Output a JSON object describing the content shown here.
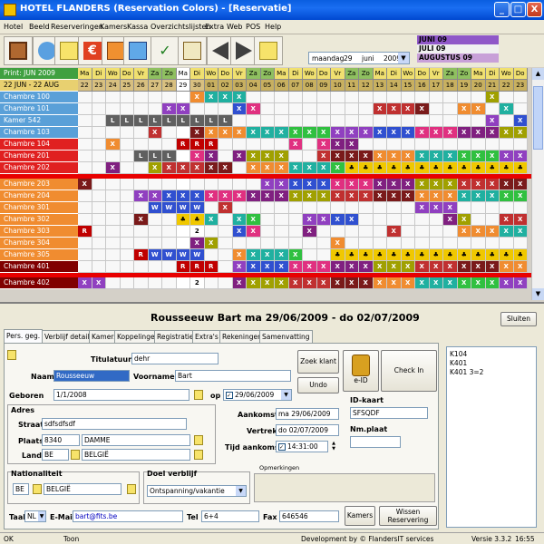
{
  "window": {
    "title": "HOTEL FLANDERS  (Reservation Colors) - [Reservatie]",
    "btn_min": "_",
    "btn_max": "□",
    "btn_close": "X"
  },
  "menu": [
    "Hotel",
    "Beeld",
    "Reserveringen",
    "Kamers",
    "Kassa",
    "Overzichtslijsten",
    "Extra",
    "Web",
    "POS",
    "Help"
  ],
  "toolbar": {
    "date": {
      "day_name": "maandag",
      "day": "29",
      "month": "juni",
      "year": "2009"
    },
    "months": [
      {
        "label": "JUNI 09",
        "color": "#8f57c8"
      },
      {
        "label": "JULI 09",
        "color": "#f0f0f0"
      },
      {
        "label": "AUGUSTUS 09",
        "color": "#c8a0d8"
      }
    ]
  },
  "planner": {
    "print_label": "Print: JUN 2009",
    "range_label": "22 JUN - 22 AUG",
    "weekdays": [
      "Ma",
      "Di",
      "Wo",
      "Do",
      "Vr",
      "Za",
      "Zo",
      "Ma",
      "Di",
      "Wo",
      "Do",
      "Vr",
      "Za",
      "Zo",
      "Ma",
      "Di",
      "Wo",
      "Do",
      "Vr",
      "Za",
      "Zo",
      "Ma",
      "Di",
      "Wo",
      "Do",
      "Vr",
      "Za",
      "Zo",
      "Ma",
      "Di",
      "Wo",
      "Do"
    ],
    "dates": [
      "22",
      "23",
      "24",
      "25",
      "26",
      "27",
      "28",
      "29",
      "30",
      "01",
      "02",
      "03",
      "04",
      "05",
      "06",
      "07",
      "08",
      "09",
      "10",
      "11",
      "12",
      "13",
      "14",
      "15",
      "16",
      "17",
      "18",
      "19",
      "20",
      "21",
      "22",
      "23"
    ],
    "rooms": [
      {
        "name": "Chambre 100",
        "color": "#5aa0d8",
        "cells": {
          "8": "X",
          "9": "X",
          "10": "X",
          "11": "X",
          "29": "X"
        }
      },
      {
        "name": "Chambre 101",
        "color": "#5aa0d8",
        "cells": {
          "6": "X",
          "7": "X",
          "11": "X",
          "12": "X",
          "21": "X",
          "22": "X",
          "23": "X",
          "24": "X",
          "27": "X",
          "28": "X",
          "30": "X"
        }
      },
      {
        "name": "Kamer 542",
        "color": "#5aa0d8",
        "cells": {
          "2": "L",
          "3": "L",
          "4": "L",
          "5": "L",
          "6": "L",
          "7": "L",
          "8": "L",
          "9": "L",
          "10": "L",
          "29": "X",
          "31": "X"
        }
      },
      {
        "name": "Chambre 103",
        "color": "#5aa0d8",
        "cells": {
          "5": "X",
          "8": "X",
          "9": "X",
          "10": "X",
          "11": "X",
          "12": "X",
          "13": "X",
          "14": "X",
          "15": "X",
          "16": "X",
          "17": "X",
          "18": "X",
          "19": "X",
          "20": "X",
          "21": "X",
          "22": "X",
          "23": "X",
          "24": "X",
          "25": "X",
          "26": "X",
          "27": "X",
          "28": "X",
          "29": "X",
          "30": "X",
          "31": "X"
        }
      },
      {
        "name": "Chambre 104",
        "color": "#e02020",
        "cells": {
          "2": "X",
          "7": "R",
          "8": "R",
          "9": "R",
          "15": "X",
          "17": "X",
          "18": "X",
          "19": "X"
        }
      },
      {
        "name": "Chambre 201",
        "color": "#e02020",
        "cells": {
          "4": "L",
          "5": "L",
          "6": "L",
          "8": "X",
          "9": "X",
          "11": "X",
          "12": "X",
          "13": "X",
          "14": "X",
          "17": "X",
          "18": "X",
          "19": "X",
          "20": "X",
          "21": "X",
          "22": "X",
          "23": "X",
          "24": "X",
          "25": "X",
          "26": "X",
          "27": "X",
          "28": "X",
          "29": "X",
          "30": "X",
          "31": "X"
        }
      },
      {
        "name": "Chambre 202",
        "color": "#e02020",
        "cells": {
          "2": "X",
          "5": "X",
          "6": "X",
          "7": "X",
          "8": "X",
          "9": "X",
          "10": "X",
          "12": "X",
          "13": "X",
          "14": "X",
          "15": "X",
          "16": "X",
          "17": "X",
          "18": "X",
          "19": "♣",
          "20": "♣",
          "21": "♣",
          "22": "♣",
          "23": "♣",
          "24": "♣",
          "25": "♣",
          "26": "♣",
          "27": "♣",
          "28": "♣",
          "29": "♣",
          "30": "♣",
          "31": "♣"
        }
      },
      {
        "name": "Chambre 203",
        "color": "#f08c30",
        "cells": {
          "0": "X",
          "13": "X",
          "14": "X",
          "15": "X",
          "16": "X",
          "17": "X",
          "18": "X",
          "19": "X",
          "20": "X",
          "21": "X",
          "22": "X",
          "23": "X",
          "24": "X",
          "25": "X",
          "26": "X",
          "27": "X",
          "28": "X",
          "29": "X",
          "30": "X",
          "31": "X"
        }
      },
      {
        "name": "Chambre 204",
        "color": "#f08c30",
        "cells": {
          "4": "X",
          "5": "X",
          "6": "X",
          "7": "X",
          "8": "X",
          "9": "X",
          "10": "X",
          "11": "X",
          "12": "X",
          "13": "X",
          "14": "X",
          "15": "X",
          "16": "X",
          "17": "X",
          "18": "X",
          "19": "X",
          "20": "X",
          "21": "X",
          "22": "X",
          "23": "X",
          "24": "X",
          "25": "X",
          "26": "X",
          "27": "X",
          "28": "X",
          "29": "X",
          "30": "X",
          "31": "X"
        }
      },
      {
        "name": "Chambre 301",
        "color": "#f08c30",
        "cells": {
          "5": "W",
          "6": "W",
          "7": "W",
          "8": "W",
          "10": "X",
          "24": "X",
          "25": "X",
          "26": "X"
        }
      },
      {
        "name": "Chambre 302",
        "color": "#f08c30",
        "cells": {
          "4": "X",
          "7": "♣",
          "8": "♣",
          "9": "X",
          "11": "X",
          "12": "X",
          "16": "X",
          "17": "X",
          "18": "X",
          "19": "X",
          "26": "X",
          "27": "X",
          "30": "X",
          "31": "X"
        }
      },
      {
        "name": "Chambre 303",
        "color": "#f08c30",
        "cells": {
          "0": "R",
          "8": "2",
          "11": "X",
          "12": "X",
          "16": "X",
          "22": "X",
          "27": "X",
          "28": "X",
          "29": "X",
          "30": "X",
          "31": "X"
        }
      },
      {
        "name": "Chambre 304",
        "color": "#f08c30",
        "cells": {
          "8": "X",
          "9": "X",
          "18": "X"
        }
      },
      {
        "name": "Chambre 305",
        "color": "#f08c30",
        "cells": {
          "4": "R",
          "5": "W",
          "6": "W",
          "7": "W",
          "8": "W",
          "11": "X",
          "12": "X",
          "13": "X",
          "14": "X",
          "15": "X",
          "18": "♣",
          "19": "♣",
          "20": "♣",
          "21": "♣",
          "22": "♣",
          "23": "♣",
          "24": "♣",
          "25": "♣",
          "26": "♣",
          "27": "♣",
          "28": "♣",
          "29": "♣",
          "30": "♣",
          "31": "♣"
        }
      },
      {
        "name": "Chambre 401",
        "color": "#800000",
        "cells": {
          "7": "R",
          "8": "R",
          "9": "R",
          "11": "X",
          "12": "X",
          "13": "X",
          "14": "X",
          "15": "X",
          "16": "X",
          "17": "X",
          "18": "X",
          "19": "X",
          "20": "X",
          "21": "X",
          "22": "X",
          "23": "X",
          "24": "X",
          "25": "X",
          "26": "X",
          "27": "X",
          "28": "X",
          "29": "X",
          "30": "X",
          "31": "X"
        }
      },
      {
        "name": "Chambre 402",
        "color": "#800000",
        "cells": {
          "0": "X",
          "1": "X",
          "8": "2",
          "11": "X",
          "12": "X",
          "13": "X",
          "14": "X",
          "15": "X",
          "16": "X",
          "17": "X",
          "18": "X",
          "19": "X",
          "20": "X",
          "21": "X",
          "22": "X",
          "23": "X",
          "24": "X",
          "25": "X",
          "26": "X",
          "27": "X",
          "28": "X",
          "29": "X",
          "30": "X",
          "31": "X"
        }
      }
    ],
    "codes": {
      "X": "#6a2a9a",
      "L": "#606060",
      "R": "#c00000",
      "W": "#3050d0",
      "2": "#ffffff",
      "♣": "#f0c800"
    },
    "code_colors": [
      "#c03030",
      "#7a1a1a",
      "#f08c30",
      "#20b0a0",
      "#30c040",
      "#9040c0",
      "#3050d0",
      "#e03080",
      "#802080",
      "#a0a000"
    ]
  },
  "reservation": {
    "header": "Rousseeuw Bart   ma 29/06/2009 - do 02/07/2009",
    "close_label": "Sluiten",
    "tabs": [
      "Pers. geg.",
      "Verblijf details",
      "Kamers",
      "Koppelingen",
      "Registratie",
      "Extra's",
      "Rekeningen",
      "Samenvatting"
    ],
    "titulatuur_label": "Titulatuur",
    "titulatuur": "dehr",
    "naam_label": "Naam",
    "naam": "Rousseeuw",
    "voornamen_label": "Voornamen",
    "voornamen": "Bart",
    "zoek_klant": "Zoek klant",
    "undo": "Undo",
    "eid_label": "e-ID",
    "check_in": "Check In",
    "geboren_label": "Geboren",
    "geboren": "1/1/2008",
    "op_label": "op",
    "op_date": "29/06/2009",
    "adres_label": "Adres",
    "straat_label": "Straat",
    "straat": "sdfsdfsdf",
    "plaats_label": "Plaats",
    "postcode": "8340",
    "plaats": "DAMME",
    "land_label": "Land",
    "land_code": "BE",
    "land": "BELGIË",
    "aankomst_label": "Aankomst",
    "aankomst": "ma 29/06/2009",
    "vertrek_label": "Vertrek",
    "vertrek": "do 02/07/2009",
    "tijd_label": "Tijd aankomst",
    "tijd": "14:31:00",
    "idkaart_label": "ID-kaart",
    "idkaart": "SFSQDF",
    "nmplaat_label": "Nm.plaat",
    "nmplaat": "",
    "nationaliteit_label": "Nationaliteit",
    "nat_code": "BE",
    "nat": "BELGIË",
    "doel_label": "Doel verblijf",
    "doel": "Ontspanning/vakantie",
    "opmerkingen_label": "Opmerkingen",
    "taal_label": "Taal",
    "taal": "NL",
    "email_label": "E-Mail",
    "email": "bart@fits.be",
    "tel_label": "Tel",
    "tel": "6+4",
    "fax_label": "Fax",
    "fax": "646546",
    "kamers_btn": "Kamers",
    "wissen_btn_1": "Wissen",
    "wissen_btn_2": "Reservering",
    "rooms_summary": [
      "K104",
      "K401",
      "K401 3=2"
    ]
  },
  "status": {
    "ok": "OK",
    "toon": "Toon",
    "dev": "Development by © FlandersIT services",
    "version": "Versie 3.3.2",
    "time": "16:55"
  }
}
